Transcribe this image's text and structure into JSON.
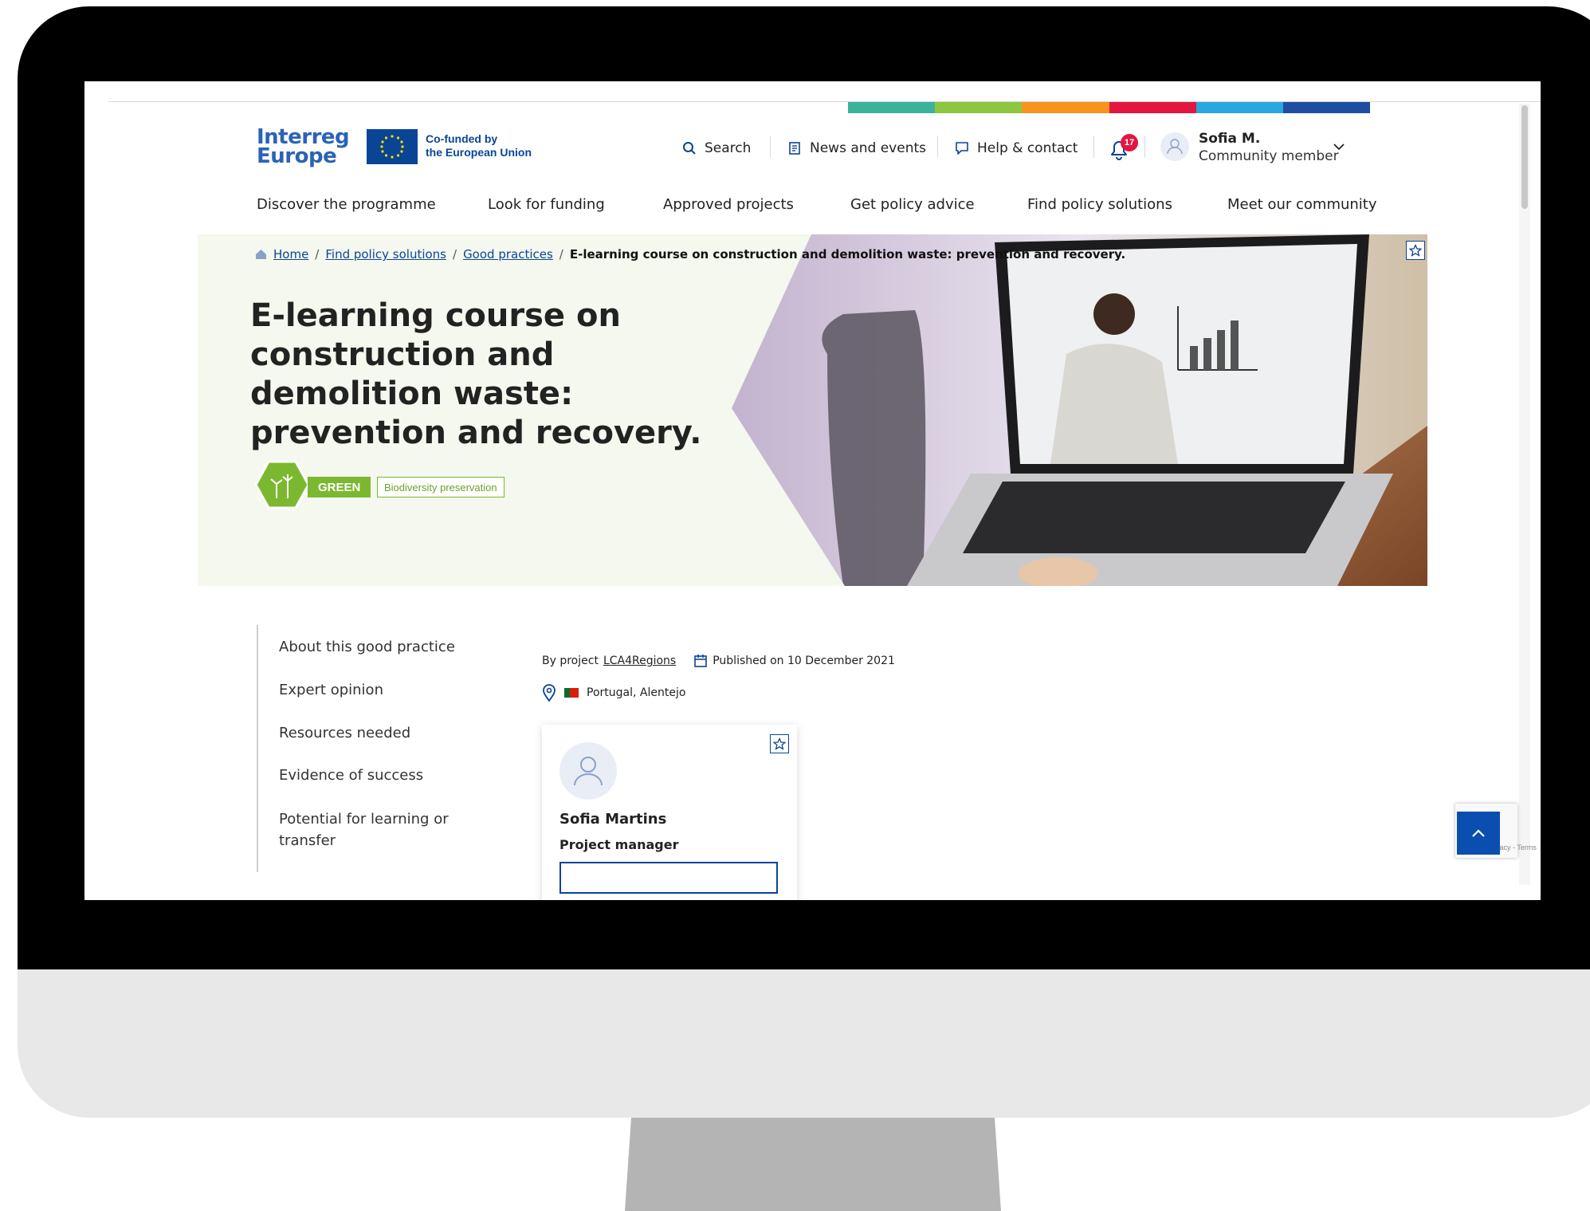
{
  "header": {
    "logo": {
      "line1": "Interreg",
      "line2": "Europe"
    },
    "eu_text": {
      "line1": "Co-funded by",
      "line2": "the European Union"
    },
    "tools": {
      "search": "Search",
      "news": "News and events",
      "help": "Help & contact"
    },
    "notifications_count": "17",
    "user": {
      "name": "Sofia M.",
      "role": "Community member"
    },
    "brand_colors": [
      "#3bb39a",
      "#8dc63f",
      "#f7941d",
      "#e2163f",
      "#29a8e0",
      "#1f4ea1"
    ]
  },
  "nav": {
    "items": [
      "Discover the programme",
      "Look for funding",
      "Approved projects",
      "Get policy advice",
      "Find policy solutions",
      "Meet our community"
    ]
  },
  "breadcrumb": {
    "items": [
      "Home",
      "Find policy solutions",
      "Good practices"
    ],
    "current": "E-learning course on construction and demolition waste: prevention and recovery."
  },
  "hero": {
    "title": "E-learning course on construction and demolition waste: prevention and recovery.",
    "tag_label": "GREEN",
    "tag_sub": "Biodiversity preservation"
  },
  "sidenav": {
    "items": [
      "About this good practice",
      "Expert opinion",
      "Resources needed",
      "Evidence of success",
      "Potential for learning or transfer"
    ]
  },
  "meta": {
    "by_project_label": "By project",
    "project_name": "LCA4Regions",
    "published": "Published on 10 December 2021",
    "location": "Portugal, Alentejo"
  },
  "contact_card": {
    "name": "Sofia Martins",
    "role": "Project manager"
  },
  "recaptcha": {
    "text": "Privacy - Terms"
  }
}
